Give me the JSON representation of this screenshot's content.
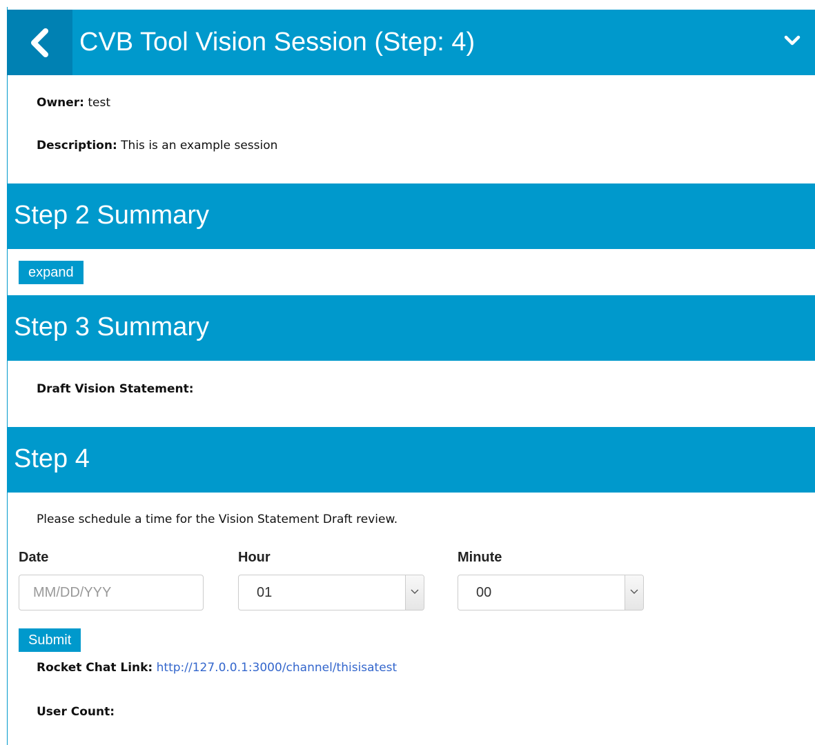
{
  "header": {
    "title": "CVB Tool Vision Session (Step: 4)",
    "back_icon": "chevron-left-icon",
    "menu_icon": "chevron-down-icon"
  },
  "session": {
    "owner_label": "Owner:",
    "owner_value": "test",
    "description_label": "Description:",
    "description_value": "This is an example session"
  },
  "step2": {
    "title": "Step 2 Summary",
    "expand_label": "expand"
  },
  "step3": {
    "title": "Step 3 Summary",
    "draft_label": "Draft Vision Statement:"
  },
  "step4": {
    "title": "Step 4",
    "instruction": "Please schedule a time for the Vision Statement Draft review.",
    "date_label": "Date",
    "date_placeholder": "MM/DD/YYY",
    "hour_label": "Hour",
    "hour_value": "01",
    "minute_label": "Minute",
    "minute_value": "00",
    "submit_label": "Submit",
    "chat_label": "Rocket Chat Link:",
    "chat_link": "http://127.0.0.1:3000/channel/thisisatest",
    "user_count_label": "User Count:"
  },
  "colors": {
    "brand": "#0099cc",
    "brand_dark": "#0081b3",
    "link": "#3366cc"
  }
}
